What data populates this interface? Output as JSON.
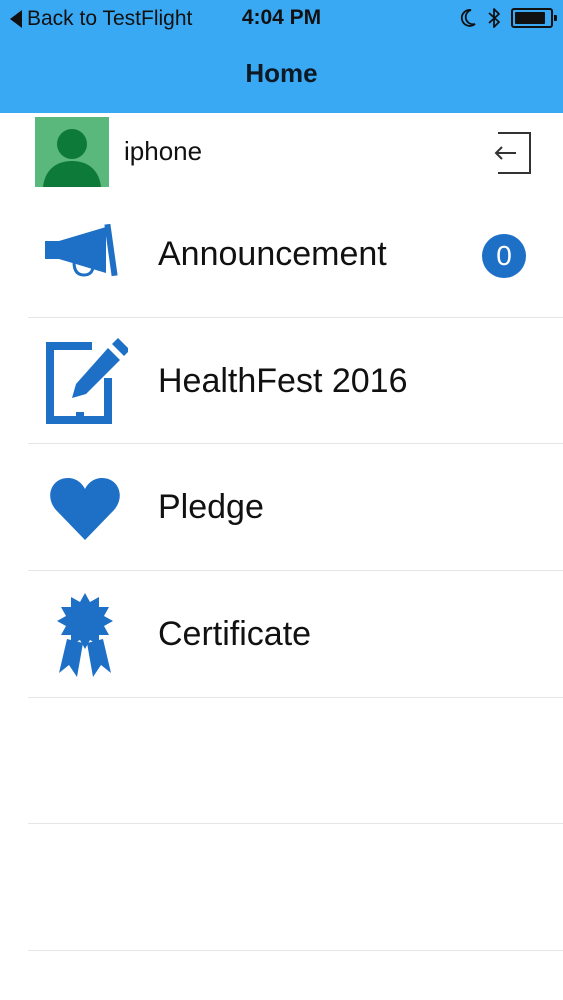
{
  "status_bar": {
    "back_label": "Back to TestFlight",
    "time": "4:04 PM"
  },
  "nav": {
    "title": "Home"
  },
  "user": {
    "name": "iphone"
  },
  "menu": {
    "items": [
      {
        "label": "Announcement",
        "icon": "megaphone-icon",
        "badge": "0"
      },
      {
        "label": "HealthFest 2016",
        "icon": "tablet-pencil-icon"
      },
      {
        "label": "Pledge",
        "icon": "heart-icon"
      },
      {
        "label": "Certificate",
        "icon": "award-ribbon-icon"
      }
    ]
  },
  "colors": {
    "header_bg": "#3aa9f4",
    "icon_blue": "#1e6fc6",
    "avatar_bg": "#5bb87c",
    "avatar_fg": "#0e7a3a"
  }
}
